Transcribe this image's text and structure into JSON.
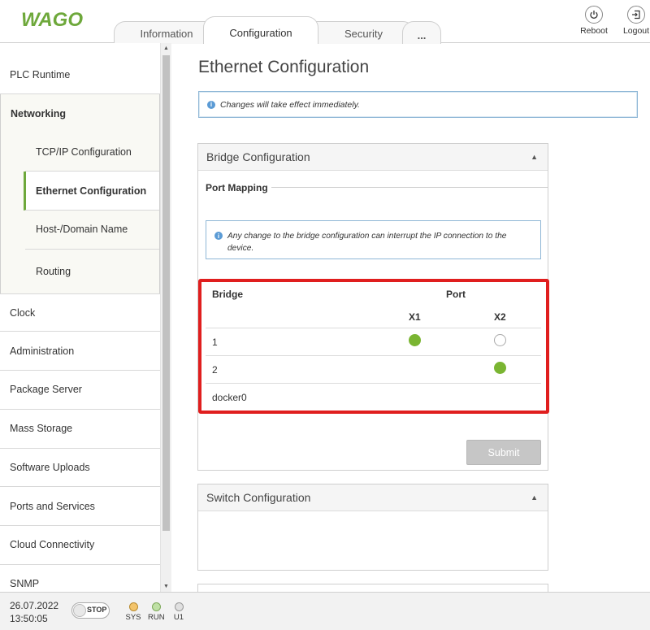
{
  "brand": {
    "logo_text": "WAGO",
    "color": "#6ea83b"
  },
  "header": {
    "tabs": [
      {
        "label": "Information"
      },
      {
        "label": "Configuration"
      },
      {
        "label": "Security"
      },
      {
        "label": "..."
      }
    ],
    "reboot_label": "Reboot",
    "logout_label": "Logout"
  },
  "sidebar": {
    "items": [
      {
        "label": "PLC Runtime"
      },
      {
        "label": "Networking"
      },
      {
        "label": "Clock"
      },
      {
        "label": "Administration"
      },
      {
        "label": "Package Server"
      },
      {
        "label": "Mass Storage"
      },
      {
        "label": "Software Uploads"
      },
      {
        "label": "Ports and Services"
      },
      {
        "label": "Cloud Connectivity"
      },
      {
        "label": "SNMP"
      }
    ],
    "networking_sub": [
      {
        "label": "TCP/IP Configuration"
      },
      {
        "label": "Ethernet Configuration"
      },
      {
        "label": "Host-/Domain Name"
      },
      {
        "label": "Routing"
      }
    ]
  },
  "main": {
    "title": "Ethernet Configuration",
    "notice": "Changes will take effect immediately.",
    "bridge_panel": {
      "title": "Bridge Configuration",
      "port_mapping_label": "Port Mapping",
      "warning": "Any change to the bridge configuration can interrupt the IP connection to the device.",
      "table": {
        "col_bridge": "Bridge",
        "col_port": "Port",
        "col_x1": "X1",
        "col_x2": "X2",
        "rows": [
          {
            "name": "1",
            "x1": true,
            "x2": false
          },
          {
            "name": "2",
            "x1": null,
            "x2": true
          },
          {
            "name": "docker0",
            "x1": null,
            "x2": null
          }
        ]
      },
      "submit_label": "Submit"
    },
    "switch_panel": {
      "title": "Switch Configuration"
    }
  },
  "footer": {
    "date": "26.07.2022",
    "time": "13:50:05",
    "stop_label": "STOP",
    "leds": [
      {
        "label": "SYS",
        "color": "#f3c46b"
      },
      {
        "label": "RUN",
        "color": "#bfe0a5"
      },
      {
        "label": "U1",
        "color": "#e0e0e0"
      }
    ]
  }
}
